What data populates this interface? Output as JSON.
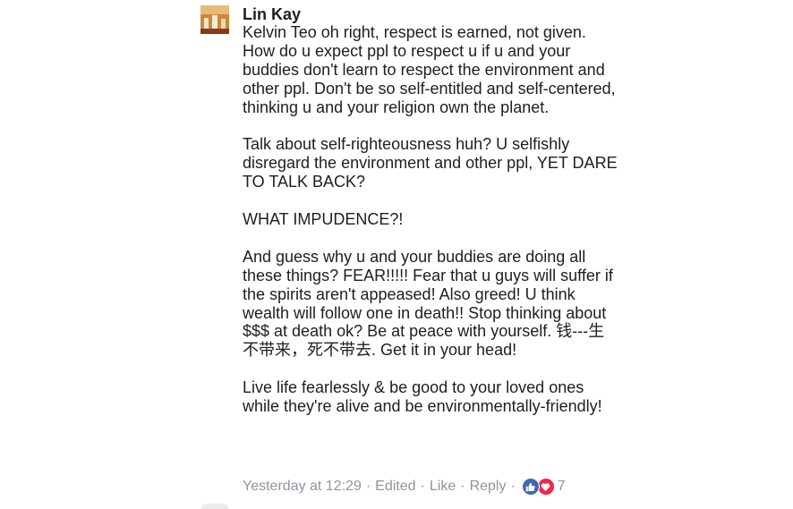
{
  "comment": {
    "author": "Lin Kay",
    "avatar_icon": "avatar-photo-icon",
    "paragraphs": [
      "Kelvin Teo oh right, respect is earned, not given. How do u expect ppl to respect u if u and your buddies don't learn to respect the environment and other ppl. Don't be so self-entitled and self-centered, thinking u and your religion own the planet.",
      "Talk about self-righteousness huh? U selfishly disregard the environment and other ppl, YET DARE TO TALK BACK?",
      "WHAT IMPUDENCE?!",
      "And guess why u and your buddies are doing all these things? FEAR!!!!! Fear that u guys will suffer if the spirits aren't appeased! Also greed! U think wealth will follow one in death!! Stop thinking about $$$ at death ok? Be at peace with yourself. 钱---生不带来，死不带去. Get it in your head!",
      "Live life fearlessly & be good to your loved ones while they're alive and be environmentally-friendly!"
    ],
    "meta": {
      "timestamp": "Yesterday at 12:29",
      "edited": "Edited",
      "like_label": "Like",
      "reply_label": "Reply",
      "separator": "·",
      "reaction_count": "7",
      "reaction_icons": [
        "like-reaction-icon",
        "love-reaction-icon"
      ],
      "colors": {
        "like": "#4267b2",
        "love": "#f0284a",
        "meta_text": "#90949c"
      }
    }
  }
}
